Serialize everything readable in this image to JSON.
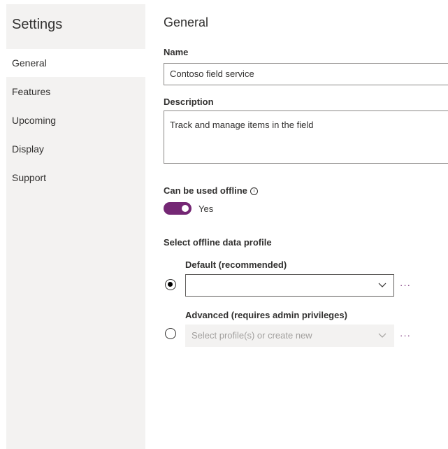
{
  "sidebar": {
    "title": "Settings",
    "items": [
      {
        "label": "General",
        "active": true
      },
      {
        "label": "Features"
      },
      {
        "label": "Upcoming"
      },
      {
        "label": "Display"
      },
      {
        "label": "Support"
      }
    ]
  },
  "main": {
    "title": "General",
    "name_label": "Name",
    "name_value": "Contoso field service",
    "description_label": "Description",
    "description_value": "Track and manage items in the field",
    "offline_label": "Can be used offline",
    "offline_toggle_state": "Yes",
    "profile_section_label": "Select offline data profile",
    "default_option": {
      "label": "Default (recommended)",
      "selected": true,
      "value": ""
    },
    "advanced_option": {
      "label": "Advanced (requires admin privileges)",
      "selected": false,
      "placeholder": "Select profile(s) or create new"
    },
    "more_label": "···"
  },
  "colors": {
    "accent": "#742774",
    "sidebar_bg": "#f3f2f1"
  }
}
